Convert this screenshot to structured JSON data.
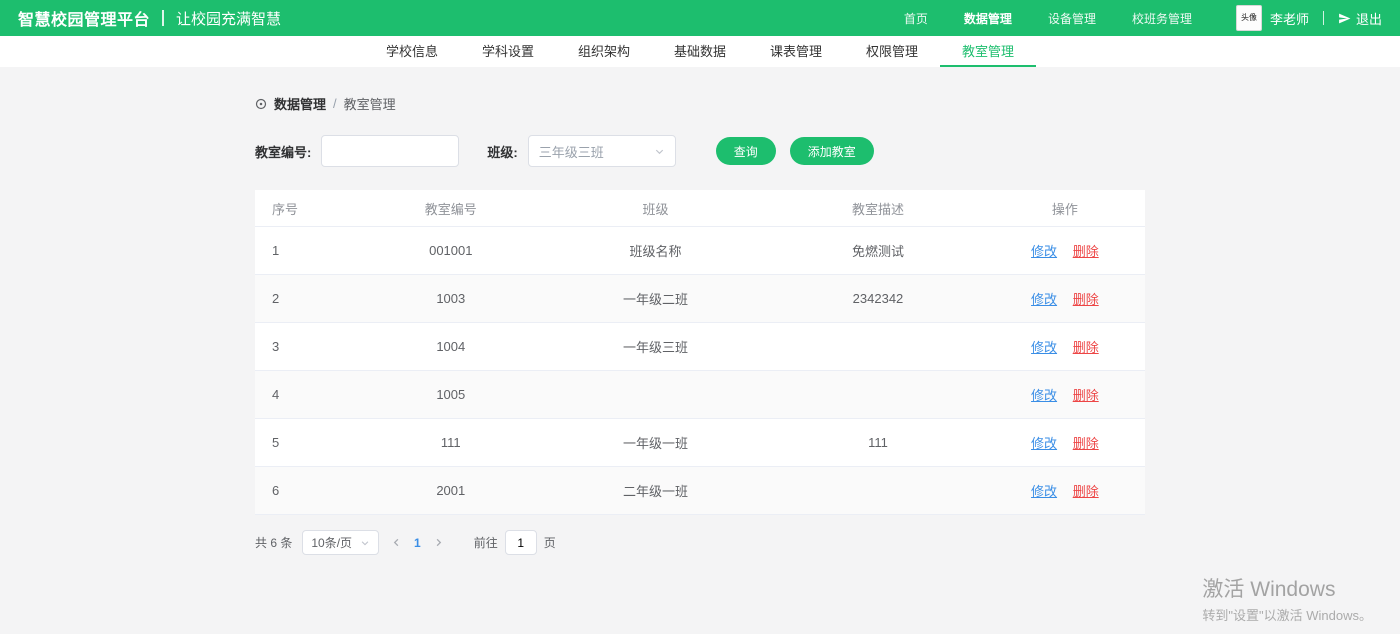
{
  "header": {
    "brand": "智慧校园管理平台",
    "slogan": "让校园充满智慧",
    "nav": [
      {
        "label": "首页",
        "active": false
      },
      {
        "label": "数据管理",
        "active": true
      },
      {
        "label": "设备管理",
        "active": false
      },
      {
        "label": "校班务管理",
        "active": false
      }
    ],
    "avatar_text": "头像",
    "username": "李老师",
    "logout_label": "退出"
  },
  "tabs": [
    {
      "label": "学校信息",
      "active": false
    },
    {
      "label": "学科设置",
      "active": false
    },
    {
      "label": "组织架构",
      "active": false
    },
    {
      "label": "基础数据",
      "active": false
    },
    {
      "label": "课表管理",
      "active": false
    },
    {
      "label": "权限管理",
      "active": false
    },
    {
      "label": "教室管理",
      "active": true
    }
  ],
  "breadcrumb": {
    "section": "数据管理",
    "separator": "/",
    "current": "教室管理"
  },
  "filters": {
    "room_label": "教室编号:",
    "room_value": "",
    "class_label": "班级:",
    "class_value": "三年级三班",
    "search_button": "查询",
    "add_button": "添加教室"
  },
  "table": {
    "columns": [
      "序号",
      "教室编号",
      "班级",
      "教室描述",
      "操作"
    ],
    "edit_label": "修改",
    "delete_label": "删除",
    "rows": [
      {
        "index": "1",
        "room": "001001",
        "class": "班级名称",
        "desc": "免燃测试"
      },
      {
        "index": "2",
        "room": "1003",
        "class": "一年级二班",
        "desc": "2342342"
      },
      {
        "index": "3",
        "room": "1004",
        "class": "一年级三班",
        "desc": ""
      },
      {
        "index": "4",
        "room": "1005",
        "class": "",
        "desc": ""
      },
      {
        "index": "5",
        "room": "111",
        "class": "一年级一班",
        "desc": "111"
      },
      {
        "index": "6",
        "room": "2001",
        "class": "二年级一班",
        "desc": ""
      }
    ]
  },
  "pagination": {
    "total": "共 6 条",
    "page_size": "10条/页",
    "current_page": "1",
    "goto_label": "前往",
    "goto_value": "1",
    "page_suffix": "页"
  },
  "watermark": {
    "line1": "激活 Windows",
    "line2": "转到\"设置\"以激活 Windows。"
  },
  "colors": {
    "green": "#1dbe6e",
    "edit_blue": "#3a8ee6",
    "delete_red": "#ed4545"
  }
}
